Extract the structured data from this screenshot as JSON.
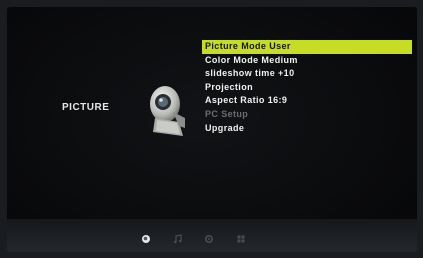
{
  "section": {
    "title": "PICTURE",
    "icon": "webcam-icon"
  },
  "menu": {
    "items": [
      {
        "label": "Picture Mode User",
        "state": "selected"
      },
      {
        "label": "Color Mode Medium",
        "state": "normal"
      },
      {
        "label": "slideshow time +10",
        "state": "normal"
      },
      {
        "label": "Projection",
        "state": "normal"
      },
      {
        "label": "Aspect Ratio 16:9",
        "state": "normal"
      },
      {
        "label": "PC Setup",
        "state": "disabled"
      },
      {
        "label": "Upgrade",
        "state": "normal"
      }
    ]
  },
  "bottom_tabs": [
    {
      "icon": "picture-tab-icon",
      "active": true
    },
    {
      "icon": "music-tab-icon",
      "active": false
    },
    {
      "icon": "settings-tab-icon",
      "active": false
    },
    {
      "icon": "grid-tab-icon",
      "active": false
    }
  ],
  "colors": {
    "highlight": "#c6dd23",
    "text": "#f2f2f2",
    "disabled": "#6b6c70",
    "background": "#0b0c0e"
  }
}
